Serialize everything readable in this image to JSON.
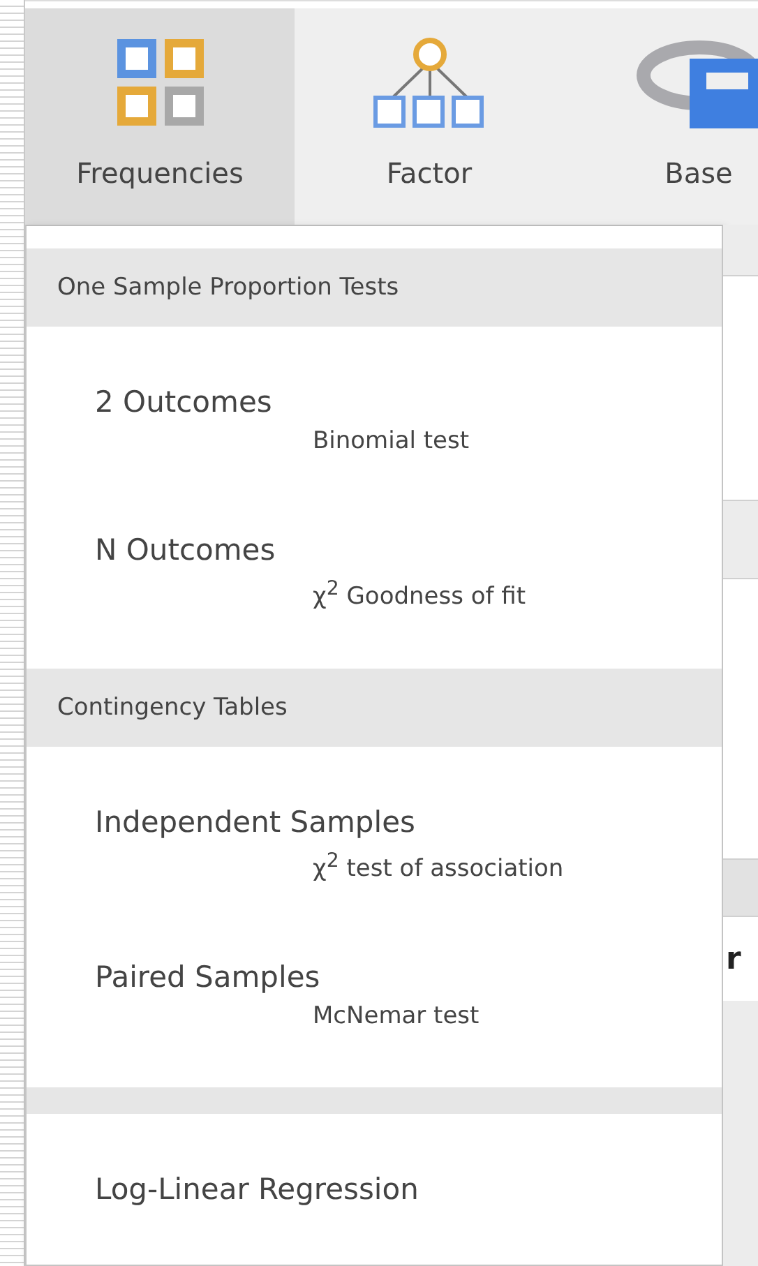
{
  "toolbar": {
    "buttons": [
      {
        "label": "Frequencies",
        "kind": "grid",
        "selected": true
      },
      {
        "label": "Factor",
        "kind": "tree",
        "selected": false
      },
      {
        "label": "Base",
        "kind": "ring",
        "selected": false
      }
    ]
  },
  "menu": {
    "sections": [
      {
        "header": "One Sample Proportion Tests",
        "items": [
          {
            "title": "2 Outcomes",
            "subtitle": "Binomial test"
          },
          {
            "title": "N Outcomes",
            "subtitle": "χ$^{2}$ Goodness of fit"
          }
        ]
      },
      {
        "header": "Contingency Tables",
        "items": [
          {
            "title": "Independent Samples",
            "subtitle": "χ$^{2}$ test of association"
          },
          {
            "title": "Paired Samples",
            "subtitle": "McNemar test"
          }
        ]
      },
      {
        "items": [
          {
            "title": "Log-Linear Regression"
          }
        ]
      }
    ]
  },
  "background": {
    "column_1": "r"
  }
}
